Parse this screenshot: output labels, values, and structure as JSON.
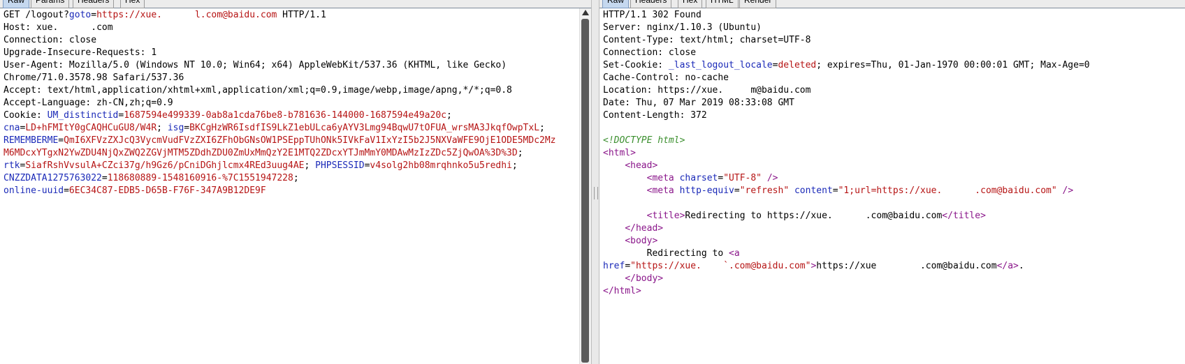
{
  "left": {
    "tabs": [
      "Raw",
      "Params",
      "Headers",
      "Hex"
    ],
    "active_tab": "Raw",
    "lines": [
      [
        {
          "t": "GET /logout?",
          "c": "k"
        },
        {
          "t": "goto",
          "c": "pn"
        },
        {
          "t": "=",
          "c": "sep"
        },
        {
          "t": "https://xue.",
          "c": "pv"
        },
        {
          "t": "      ",
          "c": "redact"
        },
        {
          "t": "l.com@baidu.com",
          "c": "pv"
        },
        {
          "t": " HTTP/1.1",
          "c": "k"
        }
      ],
      [
        {
          "t": "Host: xue.",
          "c": "k"
        },
        {
          "t": "     ",
          "c": "redact"
        },
        {
          "t": " .com",
          "c": "k"
        }
      ],
      [
        {
          "t": "Connection: close",
          "c": "k"
        }
      ],
      [
        {
          "t": "Upgrade-Insecure-Requests: 1",
          "c": "k"
        }
      ],
      [
        {
          "t": "User-Agent: Mozilla/5.0 (Windows NT 10.0; Win64; x64) AppleWebKit/537.36 (KHTML, like Gecko)",
          "c": "k"
        }
      ],
      [
        {
          "t": "Chrome/71.0.3578.98 Safari/537.36",
          "c": "k"
        }
      ],
      [
        {
          "t": "Accept: text/html,application/xhtml+xml,application/xml;q=0.9,image/webp,image/apng,*/*;q=0.8",
          "c": "k"
        }
      ],
      [
        {
          "t": "Accept-Language: zh-CN,zh;q=0.9",
          "c": "k"
        }
      ],
      [
        {
          "t": "Cookie: ",
          "c": "k"
        },
        {
          "t": "UM_distinctid",
          "c": "pn"
        },
        {
          "t": "=",
          "c": "sep"
        },
        {
          "t": "1687594e499339-0ab8a1cda76be8-b781636-144000-1687594e49a20c",
          "c": "pv"
        },
        {
          "t": ";",
          "c": "sep"
        }
      ],
      [
        {
          "t": "cna",
          "c": "pn"
        },
        {
          "t": "=",
          "c": "sep"
        },
        {
          "t": "LD+hFMItY0gCAQHCuGU8/W4R",
          "c": "pv"
        },
        {
          "t": "; ",
          "c": "sep"
        },
        {
          "t": "isg",
          "c": "pn"
        },
        {
          "t": "=",
          "c": "sep"
        },
        {
          "t": "BKCgHzWR6IsdfIS9LkZ1ebULca6yAYV3Lmg94BqwU7tOFUA_wrsMA3JkqfOwpTxL",
          "c": "pv"
        },
        {
          "t": ";",
          "c": "sep"
        }
      ],
      [
        {
          "t": "REMEMBERME",
          "c": "pn"
        },
        {
          "t": "=",
          "c": "sep"
        },
        {
          "t": "QmI6XFVzZXJcQ3VycmVudFVzZXI6ZFhObGNsOW1PSEppTUhONk5IVkFaV1IxYzI5b2J5NXVaWFE9OjE1ODE5MDc2Mz",
          "c": "pv"
        }
      ],
      [
        {
          "t": "M6MDcxYTgxN2YwZDU4NjQxZWQ2ZGVjMTM5ZDdhZDU0ZmUxMmQzY2E1MTQ2ZDcxYTJmMmY0MDAwMzIzZDc5ZjQwOA%3D%3D",
          "c": "pv"
        },
        {
          "t": ";",
          "c": "sep"
        }
      ],
      [
        {
          "t": "rtk",
          "c": "pn"
        },
        {
          "t": "=",
          "c": "sep"
        },
        {
          "t": "SiafRshVvsulA+CZci37g/h9Gz6/pCniDGhjlcmx4REd3uug4AE",
          "c": "pv"
        },
        {
          "t": "; ",
          "c": "sep"
        },
        {
          "t": "PHPSESSID",
          "c": "pn"
        },
        {
          "t": "=",
          "c": "sep"
        },
        {
          "t": "v4solg2hb08mrqhnko5u5redhi",
          "c": "pv"
        },
        {
          "t": ";",
          "c": "sep"
        }
      ],
      [
        {
          "t": "CNZZDATA1275763022",
          "c": "pn"
        },
        {
          "t": "=",
          "c": "sep"
        },
        {
          "t": "118680889-1548160916-%7C1551947228",
          "c": "pv"
        },
        {
          "t": ";",
          "c": "sep"
        }
      ],
      [
        {
          "t": "online-uuid",
          "c": "pn"
        },
        {
          "t": "=",
          "c": "sep"
        },
        {
          "t": "6EC34C87-EDB5-D65B-F76F-347A9B12DE9F",
          "c": "pv"
        }
      ]
    ]
  },
  "right": {
    "tabs": [
      "Raw",
      "Headers",
      "Hex",
      "HTML",
      "Render"
    ],
    "active_tab": "Raw",
    "lines": [
      [
        {
          "t": "HTTP/1.1 302 Found",
          "c": "k"
        }
      ],
      [
        {
          "t": "Server: nginx/1.10.3 (Ubuntu)",
          "c": "k"
        }
      ],
      [
        {
          "t": "Content-Type: text/html; charset=UTF-8",
          "c": "k"
        }
      ],
      [
        {
          "t": "Connection: close",
          "c": "k"
        }
      ],
      [
        {
          "t": "Set-Cookie: ",
          "c": "k"
        },
        {
          "t": "_last_logout_locale",
          "c": "pn"
        },
        {
          "t": "=",
          "c": "sep"
        },
        {
          "t": "deleted",
          "c": "pv"
        },
        {
          "t": "; expires=Thu, 01-Jan-1970 00:00:01 GMT; Max-Age=0",
          "c": "k"
        }
      ],
      [
        {
          "t": "Cache-Control: no-cache",
          "c": "k"
        }
      ],
      [
        {
          "t": "Location: https://xue.",
          "c": "k"
        },
        {
          "t": "     ",
          "c": "redact"
        },
        {
          "t": "m@baidu.com",
          "c": "k"
        }
      ],
      [
        {
          "t": "Date: Thu, 07 Mar 2019 08:33:08 GMT",
          "c": "k"
        }
      ],
      [
        {
          "t": "Content-Length: 372",
          "c": "k"
        }
      ],
      [],
      [
        {
          "t": "<!DOCTYPE html>",
          "c": "doc"
        }
      ],
      [
        {
          "t": "<html>",
          "c": "tag"
        }
      ],
      [
        {
          "t": "    ",
          "c": "k"
        },
        {
          "t": "<head>",
          "c": "tag"
        }
      ],
      [
        {
          "t": "        ",
          "c": "k"
        },
        {
          "t": "<meta ",
          "c": "tag"
        },
        {
          "t": "charset",
          "c": "attr"
        },
        {
          "t": "=",
          "c": "sep"
        },
        {
          "t": "\"UTF-8\"",
          "c": "aval"
        },
        {
          "t": " />",
          "c": "tag"
        }
      ],
      [
        {
          "t": "        ",
          "c": "k"
        },
        {
          "t": "<meta ",
          "c": "tag"
        },
        {
          "t": "http-equiv",
          "c": "attr"
        },
        {
          "t": "=",
          "c": "sep"
        },
        {
          "t": "\"refresh\"",
          "c": "aval"
        },
        {
          "t": " ",
          "c": "k"
        },
        {
          "t": "content",
          "c": "attr"
        },
        {
          "t": "=",
          "c": "sep"
        },
        {
          "t": "\"1;url=https://xue.",
          "c": "aval"
        },
        {
          "t": "      ",
          "c": "redact"
        },
        {
          "t": ".com@baidu.com\"",
          "c": "aval"
        },
        {
          "t": " />",
          "c": "tag"
        }
      ],
      [],
      [
        {
          "t": "        ",
          "c": "k"
        },
        {
          "t": "<title>",
          "c": "tag"
        },
        {
          "t": "Redirecting to https://xue.",
          "c": "k"
        },
        {
          "t": "      ",
          "c": "redact"
        },
        {
          "t": ".com@baidu.com",
          "c": "k"
        },
        {
          "t": "</title>",
          "c": "tag"
        }
      ],
      [
        {
          "t": "    ",
          "c": "k"
        },
        {
          "t": "</head>",
          "c": "tag"
        }
      ],
      [
        {
          "t": "    ",
          "c": "k"
        },
        {
          "t": "<body>",
          "c": "tag"
        }
      ],
      [
        {
          "t": "        Redirecting to ",
          "c": "k"
        },
        {
          "t": "<a",
          "c": "tag"
        }
      ],
      [
        {
          "t": "href",
          "c": "attr"
        },
        {
          "t": "=",
          "c": "sep"
        },
        {
          "t": "\"https://xue.",
          "c": "aval"
        },
        {
          "t": "    ",
          "c": "redact"
        },
        {
          "t": "`.com@baidu.com\"",
          "c": "aval"
        },
        {
          "t": ">",
          "c": "tag"
        },
        {
          "t": "https://xue",
          "c": "k"
        },
        {
          "t": "        ",
          "c": "redact"
        },
        {
          "t": ".com@baidu.com",
          "c": "k"
        },
        {
          "t": "</a>",
          "c": "tag"
        },
        {
          "t": ".",
          "c": "k"
        }
      ],
      [
        {
          "t": "    ",
          "c": "k"
        },
        {
          "t": "</body>",
          "c": "tag"
        }
      ],
      [
        {
          "t": "</html>",
          "c": "tag"
        }
      ]
    ]
  }
}
